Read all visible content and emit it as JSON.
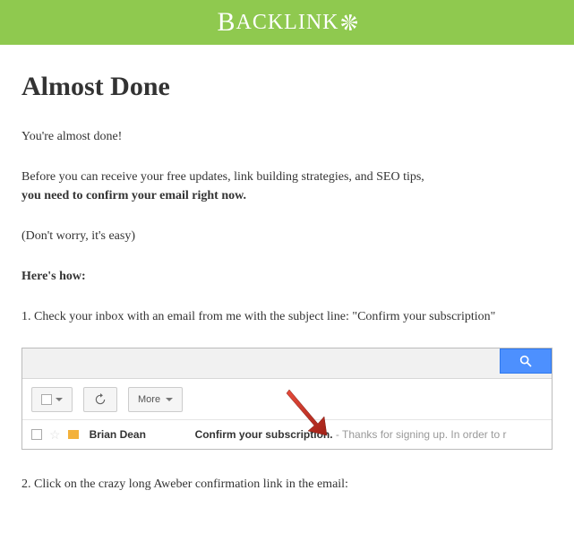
{
  "logo": {
    "text": "BACKLINK"
  },
  "heading": "Almost Done",
  "intro": "You're almost done!",
  "before_text": "Before you can receive your free updates, link building strategies, and SEO tips,",
  "confirm_bold": "you need to confirm your email right now.",
  "dont_worry": "(Don't worry, it's easy)",
  "heres_how": "Here's how:",
  "step1": "1. Check your inbox with an email from me with the subject line: \"Confirm your subscription\"",
  "step2": "2. Click on the crazy long Aweber confirmation link in the email:",
  "gmail": {
    "more_label": "More",
    "sender": "Brian Dean",
    "subject": "Confirm your subscription.",
    "preview_sep": " - ",
    "preview": "Thanks for signing up. In order to r"
  }
}
